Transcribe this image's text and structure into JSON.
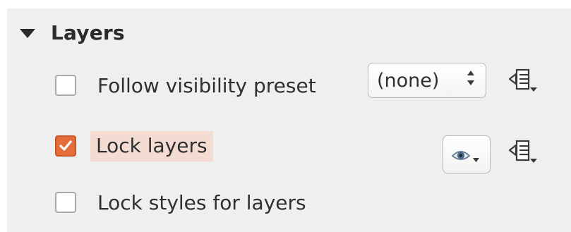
{
  "section": {
    "title": "Layers",
    "expanded": true
  },
  "rows": [
    {
      "label": "Follow visibility preset",
      "checked": false,
      "combo_value": "(none)"
    },
    {
      "label": "Lock layers",
      "checked": true
    },
    {
      "label": "Lock styles for layers",
      "checked": false
    }
  ],
  "icons": {
    "expand": "triangle-down-icon",
    "layer_menu": "layer-stack-menu-icon",
    "visibility": "eye-icon",
    "combo_arrows": "spinner-arrows-icon"
  },
  "colors": {
    "panel_bg": "#efefef",
    "checkbox_checked": "#e56d3a",
    "highlight_bg": "#f5dcd2",
    "text": "#2f2f2f"
  }
}
